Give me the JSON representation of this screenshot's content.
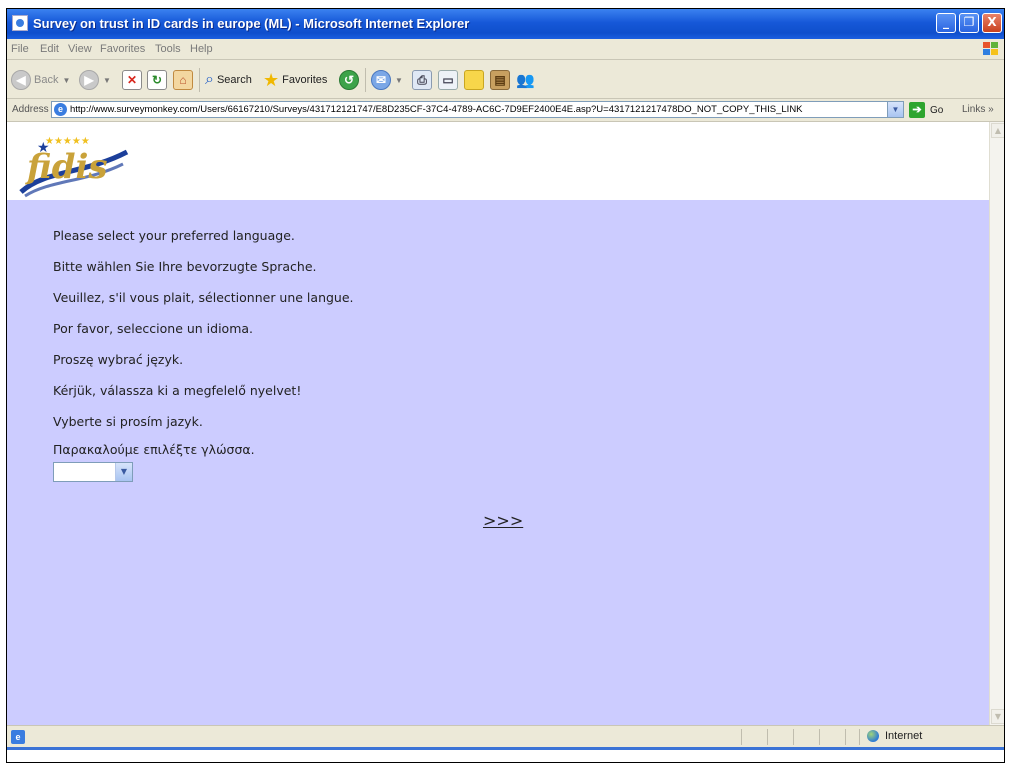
{
  "window": {
    "title": "Survey on trust in ID cards in europe (ML) - Microsoft Internet Explorer",
    "minimize_glyph": "_",
    "maximize_glyph": "❐",
    "close_glyph": "X"
  },
  "menubar": {
    "items": [
      "File",
      "Edit",
      "View",
      "Favorites",
      "Tools",
      "Help"
    ]
  },
  "toolbar": {
    "back_label": "Back",
    "search_label": "Search",
    "favorites_label": "Favorites"
  },
  "addressbar": {
    "label": "Address",
    "url": "http://www.surveymonkey.com/Users/66167210/Surveys/431712121747/E8D235CF-37C4-4789-AC6C-7D9EF2400E4E.asp?U=4317121217478DO_NOT_COPY_THIS_LINK",
    "go_label": "Go",
    "links_label": "Links"
  },
  "page": {
    "logo_text": "fidis",
    "prompts": [
      "Please select your preferred language.",
      "Bitte wählen Sie Ihre bevorzugte Sprache.",
      "Veuillez, s'il vous plait, sélectionner une langue.",
      "Por favor, seleccione un idioma.",
      "Proszę wybrać język.",
      "Kérjük, válassza ki a megfelelő nyelvet!",
      "Vyberte si prosím jazyk.",
      "Παρακαλούμε επιλέξτε γλώσσα."
    ],
    "language_select_value": "",
    "next_label": ">>>"
  },
  "statusbar": {
    "zone_label": "Internet"
  },
  "colors": {
    "form_background": "#ccccff",
    "titlebar_blue": "#1658d8",
    "chrome": "#ece9d8"
  },
  "icons": [
    "ie-page-icon",
    "back-arrow-icon",
    "forward-arrow-icon",
    "stop-icon",
    "refresh-icon",
    "home-icon",
    "search-icon",
    "favorites-star-icon",
    "history-icon",
    "mail-icon",
    "print-icon",
    "edit-icon",
    "discuss-icon",
    "research-icon",
    "messenger-icon",
    "go-arrow-icon",
    "globe-icon",
    "windows-flag-icon"
  ]
}
